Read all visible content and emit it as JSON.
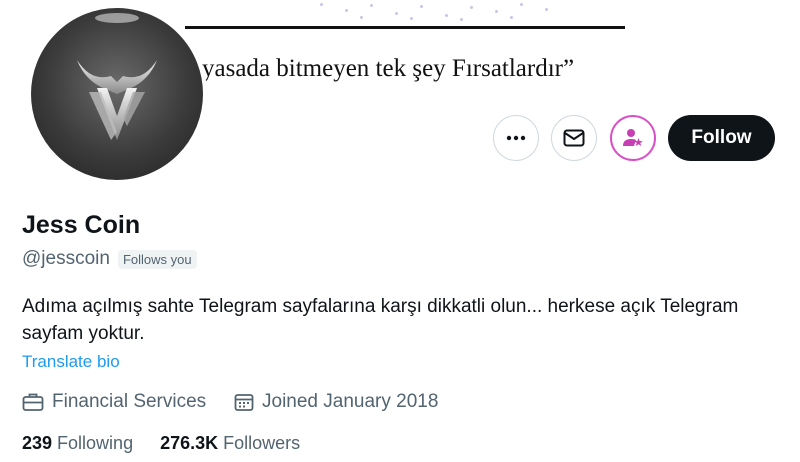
{
  "banner": {
    "quote": "yasada bitmeyen tek şey Fırsatlardır”"
  },
  "profile": {
    "name": "Jess Coin",
    "handle": "@jesscoin",
    "follows_you": "Follows you",
    "bio": "Adıma açılmış sahte Telegram sayfalarına karşı dikkatli olun... herkese açık Telegram sayfam yoktur.",
    "translate": "Translate bio",
    "category": "Financial Services",
    "joined": "Joined January 2018",
    "following_count": "239",
    "following_label": "Following",
    "followers_count": "276.3K",
    "followers_label": "Followers"
  },
  "actions": {
    "more_icon": "more-dots-icon",
    "message_icon": "envelope-icon",
    "subscribe_icon": "person-star-icon",
    "follow_label": "Follow"
  },
  "colors": {
    "link": "#1d9bf0",
    "secondary_text": "#536471",
    "subscribe_accent": "#d94fc5",
    "follow_bg": "#0f1419"
  }
}
